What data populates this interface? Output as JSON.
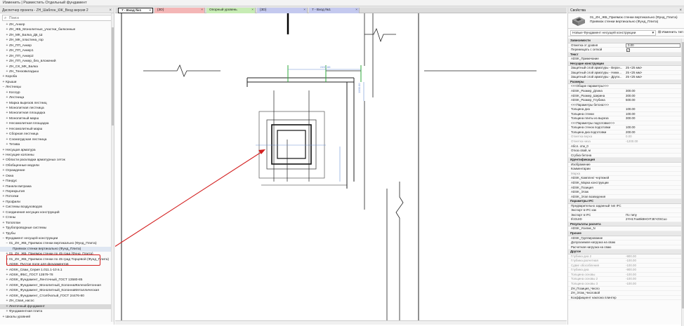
{
  "window": {
    "title": "Изменить | Разместить Отдельный фундамент",
    "accent": "#d32020"
  },
  "browser": {
    "title": "Диспетчер проекта - ZH_Шаблон_КЖ_Вход версия 2",
    "search_placeholder": "Поиск",
    "items": [
      {
        "label": "ZH_Анкер",
        "toggle": "+",
        "indent": 2
      },
      {
        "label": "ZH_ЖБ_Монолитные_участки_балконные",
        "toggle": "+",
        "indent": 2
      },
      {
        "label": "ZH_МК_Балка_Дв_Ш",
        "toggle": "+",
        "indent": 2
      },
      {
        "label": "ZH_МК_пластина_гор",
        "toggle": "+",
        "indent": 2
      },
      {
        "label": "ZH_ПП_Анкер",
        "toggle": "+",
        "indent": 2
      },
      {
        "label": "ZH_ПП_Анкер1",
        "toggle": "+",
        "indent": 2
      },
      {
        "label": "ZH_ПП_Анкер2",
        "toggle": "+",
        "indent": 2
      },
      {
        "label": "ZH_ПП_Анкер_без_вложений",
        "toggle": "+",
        "indent": 2
      },
      {
        "label": "ZH_СК_МК_Балка",
        "toggle": "+",
        "indent": 2
      },
      {
        "label": "ZH_Тензовкладыш",
        "toggle": "+",
        "indent": 2
      },
      {
        "label": "Короба",
        "toggle": "+",
        "indent": 1
      },
      {
        "label": "Крыши",
        "toggle": "+",
        "indent": 1
      },
      {
        "label": "Лестницы",
        "toggle": "−",
        "indent": 1
      },
      {
        "label": "Косоур",
        "toggle": "+",
        "indent": 2
      },
      {
        "label": "Лестница",
        "toggle": "+",
        "indent": 2
      },
      {
        "label": "Марка вырезов лестниц",
        "toggle": "+",
        "indent": 2
      },
      {
        "label": "Монолитная лестница",
        "toggle": "+",
        "indent": 2
      },
      {
        "label": "Монолитная площадка",
        "toggle": "+",
        "indent": 2
      },
      {
        "label": "Монолитный марш",
        "toggle": "+",
        "indent": 2
      },
      {
        "label": "Несомолитная площадка",
        "toggle": "+",
        "indent": 2
      },
      {
        "label": "Несомолитный марш",
        "toggle": "+",
        "indent": 2
      },
      {
        "label": "Сборная лестница",
        "toggle": "+",
        "indent": 2
      },
      {
        "label": "Сэсмогрдская лестница",
        "toggle": "+",
        "indent": 2
      },
      {
        "label": "Тетива",
        "toggle": "+",
        "indent": 2
      },
      {
        "label": "Несущая арматура",
        "toggle": "+",
        "indent": 1
      },
      {
        "label": "Несущие колонны",
        "toggle": "+",
        "indent": 1
      },
      {
        "label": "Области раскладки арматурных сеток",
        "toggle": "+",
        "indent": 1
      },
      {
        "label": "Обобщенные модели",
        "toggle": "+",
        "indent": 1
      },
      {
        "label": "Ограждение",
        "toggle": "+",
        "indent": 1
      },
      {
        "label": "Окна",
        "toggle": "+",
        "indent": 1
      },
      {
        "label": "Пандус",
        "toggle": "+",
        "indent": 1
      },
      {
        "label": "Панели витража",
        "toggle": "+",
        "indent": 1
      },
      {
        "label": "Перекрытия",
        "toggle": "+",
        "indent": 1
      },
      {
        "label": "Потолки",
        "toggle": "+",
        "indent": 1
      },
      {
        "label": "Профили",
        "toggle": "+",
        "indent": 1
      },
      {
        "label": "Системы воздуховодов",
        "toggle": "+",
        "indent": 1
      },
      {
        "label": "Соединения несущих конструкций",
        "toggle": "+",
        "indent": 1
      },
      {
        "label": "Стены",
        "toggle": "+",
        "indent": 1
      },
      {
        "label": "Топоплан",
        "toggle": "+",
        "indent": 1
      },
      {
        "label": "Трубопроводные системы",
        "toggle": "+",
        "indent": 1
      },
      {
        "label": "Трубы",
        "toggle": "+",
        "indent": 1
      },
      {
        "label": "Фундамент несущей конструкции",
        "toggle": "−",
        "indent": 1
      },
      {
        "label": "01_ZH_ЖБ_Приямок стенки вертикально (Фунд_Плита)",
        "toggle": "−",
        "indent": 2
      },
      {
        "label": "Приямок стенки вертикально (Фунд_Плита)",
        "toggle": "",
        "indent": 3,
        "state": "sel"
      },
      {
        "label": "01_ZH_ЖБ_Приямок стенки по 45 град (Фунд_Плита)",
        "toggle": "+",
        "indent": 2
      },
      {
        "label": "01_ZH_ЖБ_Приямок стенки по 45 град Торцевой (Фунд_Плита)",
        "toggle": "+",
        "indent": 2
      },
      {
        "label": "ADSK_Пустое поле для фундаментов",
        "toggle": "+",
        "indent": 2
      },
      {
        "label": "ADSK_Сваи_Серия 1.011.1-10 в.1",
        "toggle": "+",
        "indent": 2
      },
      {
        "label": "ADSK_ФБС_ГОСТ 13579-78",
        "toggle": "+",
        "indent": 2
      },
      {
        "label": "ADSK_Фундамент_Ленточный_ГОСТ 13580-85",
        "toggle": "+",
        "indent": 2
      },
      {
        "label": "ADSK_Фундамент_Монолитный_КолоннаЖелезобетонная",
        "toggle": "+",
        "indent": 2
      },
      {
        "label": "ADSK_Фундамент_Монолитный_КолоннаМеталлическая",
        "toggle": "+",
        "indent": 2
      },
      {
        "label": "ADSK_Фундамент_Столбчатый_ГОСТ 24476-80",
        "toggle": "+",
        "indent": 2
      },
      {
        "label": "ZH_Свая_насос",
        "toggle": "+",
        "indent": 2
      },
      {
        "label": "Ленточный фундамент",
        "toggle": "+",
        "indent": 2,
        "state": "highlight"
      },
      {
        "label": "Фундаментная плита",
        "toggle": "+",
        "indent": 2
      },
      {
        "label": "Шкалы уровней",
        "toggle": "+",
        "indent": 1
      }
    ]
  },
  "tabs": [
    {
      "label": "7 - Вход №1",
      "color": "#ffffff",
      "active": true
    },
    {
      "label": "{3D}",
      "color": "#f4b6b6",
      "active": false
    },
    {
      "label": "Опорный уровень",
      "color": "#c7ecb4",
      "active": false
    },
    {
      "label": "{3D}",
      "color": "#c4c9ef",
      "active": false
    },
    {
      "label": "7 - Вход №1",
      "color": "#c4c9ef",
      "active": false
    }
  ],
  "canvas": {
    "dimension_label": "2451.66",
    "dimension_label_vertical": "1000.00"
  },
  "properties": {
    "title": "Свойства",
    "type_name": "01_ZH_ЖБ_Приямок стенки вертикально (Фунд_Плита) Приямок стенки вертикально (Фунд_Плита)",
    "type_selector": "Новые Фундамент несущей конструкции",
    "edit_type": "Изменить тип",
    "rows": [
      {
        "name": "Зависимости",
        "value": "",
        "kind": "group"
      },
      {
        "name": "Отметка от уровня",
        "value": "0.00",
        "kind": "input"
      },
      {
        "name": "Перемещать с сеткой",
        "value": "✓",
        "kind": "check"
      },
      {
        "name": "Текст",
        "value": "",
        "kind": "group"
      },
      {
        "name": "ADSK_Примечание",
        "value": "",
        "kind": "row"
      },
      {
        "name": "Несущие конструкции",
        "value": "",
        "kind": "group"
      },
      {
        "name": "Защитный слой арматуры - Верхн...",
        "value": "25 <25 мм>",
        "kind": "row"
      },
      {
        "name": "Защитный слой арматуры - Нижн...",
        "value": "25 <25 мм>",
        "kind": "row"
      },
      {
        "name": "Защитный слой арматуры - Други...",
        "value": "25 <25 мм>",
        "kind": "row"
      },
      {
        "name": "Размеры",
        "value": "",
        "kind": "group"
      },
      {
        "name": "<<<Общие параметры>>>",
        "value": "",
        "kind": "row"
      },
      {
        "name": "ADSK_Размер_Длина",
        "value": "300.00",
        "kind": "row"
      },
      {
        "name": "ADSK_Размер_Ширина",
        "value": "300.00",
        "kind": "row"
      },
      {
        "name": "ADSK_Размер_Глубина",
        "value": "500.00",
        "kind": "row"
      },
      {
        "name": "<<<Параметры бетона>>>",
        "value": "",
        "kind": "row"
      },
      {
        "name": "Толщина дна",
        "value": "100.00",
        "kind": "row"
      },
      {
        "name": "Толщина стенки",
        "value": "100.00",
        "kind": "row"
      },
      {
        "name": "Толщина плиты из выреза",
        "value": "300.00",
        "kind": "row"
      },
      {
        "name": "<<<Параметры подготовки>>>",
        "value": "",
        "kind": "row"
      },
      {
        "name": "Толщина стенок подготовки",
        "value": "100.00",
        "kind": "row"
      },
      {
        "name": "Толщина дна подготовки",
        "value": "200.00",
        "kind": "row"
      },
      {
        "name": "Отметка верха",
        "value": "0.00",
        "kind": "dim"
      },
      {
        "name": "Отметка низа",
        "value": "-1200.00",
        "kind": "dim"
      },
      {
        "name": "Абсл. отм_0",
        "value": "",
        "kind": "row"
      },
      {
        "name": "Отказ свай, м",
        "value": "",
        "kind": "row"
      },
      {
        "name": "Сгубка бетона",
        "value": "",
        "kind": "row"
      },
      {
        "name": "Идентификация",
        "value": "",
        "kind": "group"
      },
      {
        "name": "Изображение",
        "value": "",
        "kind": "row"
      },
      {
        "name": "Комментарии",
        "value": "",
        "kind": "row"
      },
      {
        "name": "Марка",
        "value": "",
        "kind": "dim"
      },
      {
        "name": "ADSK_Комплект чертежей",
        "value": "",
        "kind": "row"
      },
      {
        "name": "ADSK_Марка конструкции",
        "value": "",
        "kind": "row"
      },
      {
        "name": "ADSK_Позиция",
        "value": "",
        "kind": "row"
      },
      {
        "name": "ADSK_Этаж",
        "value": "",
        "kind": "row"
      },
      {
        "name": "ADSK_Этап возведения",
        "value": "",
        "kind": "row"
      },
      {
        "name": "Параметры IFC",
        "value": "",
        "kind": "group"
      },
      {
        "name": "Предварительно заданный тип IFC",
        "value": "",
        "kind": "row"
      },
      {
        "name": "Экспорт в IFC как",
        "value": "",
        "kind": "row"
      },
      {
        "name": "Экспорт в IFC",
        "value": "По типу",
        "kind": "row"
      },
      {
        "name": "IfcGUID",
        "value": "2YH17nw9k8HOrTJEYZSCuo",
        "kind": "row"
      },
      {
        "name": "Результаты расчета",
        "value": "",
        "kind": "group"
      },
      {
        "name": "ADSK_Усилие_N",
        "value": "",
        "kind": "row"
      },
      {
        "name": "Прочее",
        "value": "",
        "kind": "group"
      },
      {
        "name": "ADSK_Группирование",
        "value": "",
        "kind": "row"
      },
      {
        "name": "Допускаемая нагрузка на сваю",
        "value": "",
        "kind": "row"
      },
      {
        "name": "Расчетная нагрузка на сваю",
        "value": "",
        "kind": "row"
      },
      {
        "name": "Другое",
        "value": "",
        "kind": "group"
      },
      {
        "name": "Глубина дна 2",
        "value": "-900.00",
        "kind": "dim"
      },
      {
        "name": "Глубина расчетная",
        "value": "-100.00",
        "kind": "dim"
      },
      {
        "name": "Сдвиг обособления",
        "value": "-100.00",
        "kind": "dim"
      },
      {
        "name": "Глубина дна",
        "value": "-900.00",
        "kind": "dim"
      },
      {
        "name": "Толщина основы",
        "value": "-100.00",
        "kind": "dim"
      },
      {
        "name": "Толщина основы 2",
        "value": "-100.00",
        "kind": "dim"
      },
      {
        "name": "Толщина основы 3",
        "value": "-100.00",
        "kind": "dim"
      },
      {
        "name": "ZH_Позиция_Число",
        "value": "",
        "kind": "row"
      },
      {
        "name": "ZH_Этаж_Числовой",
        "value": "",
        "kind": "row"
      },
      {
        "name": "Коэффициент наклона плинтер",
        "value": "",
        "kind": "row"
      }
    ]
  }
}
